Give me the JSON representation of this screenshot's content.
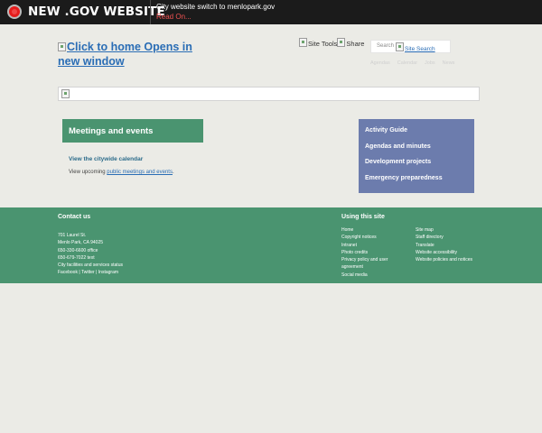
{
  "banner": {
    "title": "NEW .GOV WEBSITE",
    "message": "City website switch to menlopark.gov",
    "link": "Read On..."
  },
  "header": {
    "home_link": "Click to home Opens in new window",
    "site_tools": "Site Tools",
    "share": "Share",
    "search_placeholder": "Search",
    "search_button": "Site Search",
    "quick_links": [
      "Agendas",
      "Calendar",
      "Jobs",
      "News"
    ]
  },
  "main": {
    "meetings_heading": "Meetings and events",
    "calendar_link": "View the citywide calendar",
    "upcoming_prefix": "View upcoming",
    "upcoming_link": "public meetings and events",
    "upcoming_suffix": "."
  },
  "quick_panel": {
    "items": [
      "Activity Guide",
      "Agendas and minutes",
      "Development projects",
      "Emergency preparedness"
    ]
  },
  "footer": {
    "contact_title": "Contact us",
    "contact_lines": [
      "701 Laurel St.",
      "Menlo Park, CA 94025",
      "650-330-6600 office",
      "650-679-7022 text",
      "City facilities and services status"
    ],
    "social": [
      "Facebook",
      "Twitter",
      "Instagram"
    ],
    "social_sep": " | ",
    "using_title": "Using this site",
    "col1": [
      "Home",
      "Copyright notices",
      "Intranet",
      "Photo credits",
      "Privacy policy and user agreement",
      "Social media"
    ],
    "col2": [
      "Site map",
      "Staff directory",
      "Translate",
      "Website accessibility",
      "Website policies and notices"
    ]
  },
  "colors": {
    "banner_bg": "#1b1b1b",
    "accent_green": "#4a9470",
    "panel_blue": "#6c7cad",
    "link_blue": "#2a6db5",
    "page_bg": "#ebebe6"
  }
}
